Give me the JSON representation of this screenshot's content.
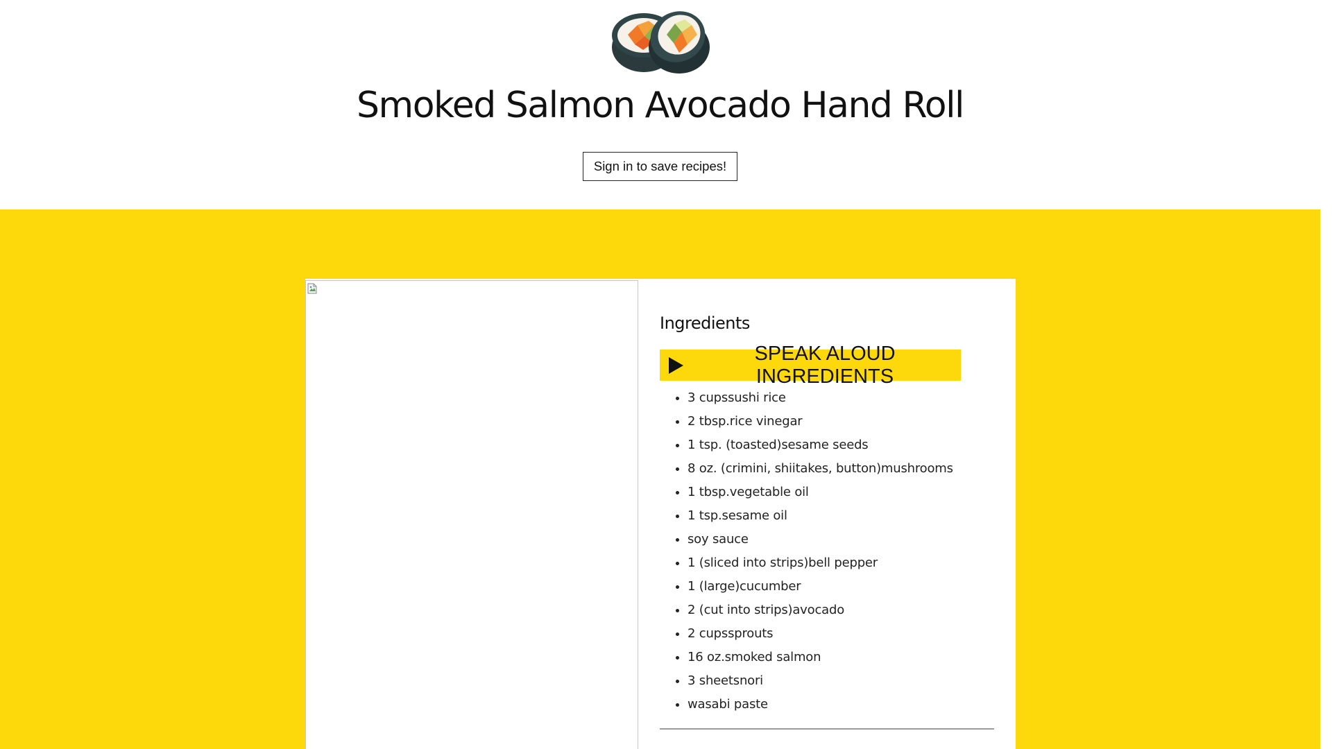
{
  "header": {
    "logo_icon": "sushi-roll-icon",
    "title": "Smoked Salmon Avocado Hand Roll",
    "signin_label": "Sign in to save recipes!"
  },
  "recipe": {
    "image_icon": "broken-image-icon",
    "ingredients_heading": "Ingredients",
    "speak_label": "SPEAK ALOUD INGREDIENTS",
    "ingredients": [
      "3 cupssushi rice",
      "2 tbsp.rice vinegar",
      "1 tsp. (toasted)sesame seeds",
      "8 oz. (crimini, shiitakes, button)mushrooms",
      "1 tbsp.vegetable oil",
      "1 tsp.sesame oil",
      "soy sauce",
      "1 (sliced into strips)bell pepper",
      "1 (large)cucumber",
      "2 (cut into strips)avocado",
      "2 cupssprouts",
      "16 oz.smoked salmon",
      "3 sheetsnori",
      "wasabi paste"
    ]
  },
  "colors": {
    "accent_yellow": "#fdd80a",
    "text": "#111111",
    "background": "#ffffff"
  }
}
